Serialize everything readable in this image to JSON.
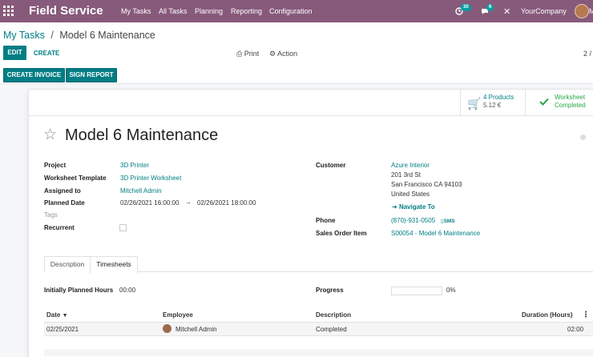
{
  "navbar": {
    "app_name": "Field Service",
    "menu": [
      "My Tasks",
      "All Tasks",
      "Planning",
      "Reporting",
      "Configuration"
    ],
    "activity_count": "30",
    "message_count": "6",
    "company": "YourCompany",
    "user_initial": "M"
  },
  "breadcrumb": {
    "parent": "My Tasks",
    "separator": "/",
    "current": "Model 6 Maintenance"
  },
  "buttons": {
    "edit": "EDIT",
    "create": "CREATE",
    "print": "Print",
    "action": "Action",
    "pager": "2 /",
    "create_invoice": "CREATE INVOICE",
    "sign_report": "SIGN REPORT"
  },
  "smart_buttons": {
    "products_count": "4 Products",
    "products_amount": "5.12 €",
    "worksheet_line1": "Worksheet",
    "worksheet_line2": "Completed"
  },
  "record": {
    "title": "Model 6 Maintenance",
    "left_fields": {
      "project_label": "Project",
      "project": "3D Printer",
      "worksheet_label": "Worksheet Template",
      "worksheet": "3D Printer Worksheet",
      "assigned_label": "Assigned to",
      "assigned": "Mitchell Admin",
      "planned_label": "Planned Date",
      "planned_start": "02/26/2021 16:00:00",
      "planned_arrow": "→",
      "planned_end": "02/26/2021 18:00:00",
      "tags_label": "Tags",
      "recurrent_label": "Recurrent"
    },
    "right_fields": {
      "customer_label": "Customer",
      "customer": "Azure Interior",
      "address1": "201 3rd St",
      "address2": "San Francisco CA 94103",
      "address3": "United States",
      "navigate": "Navigate To",
      "phone_label": "Phone",
      "phone": "(870)-931-0505",
      "sms": "SMS",
      "so_label": "Sales Order Item",
      "so": "S00054 - Model 6 Maintenance"
    }
  },
  "tabs": {
    "description": "Description",
    "timesheets": "Timesheets"
  },
  "timesheet": {
    "planned_label": "Initially Planned Hours",
    "planned_value": "00:00",
    "progress_label": "Progress",
    "progress_text": "0%",
    "progress_value": 0,
    "columns": {
      "date": "Date",
      "employee": "Employee",
      "description": "Description",
      "duration": "Duration (Hours)"
    },
    "rows": [
      {
        "date": "02/25/2021",
        "employee": "Mitchell Admin",
        "description": "Completed",
        "duration": "02:00"
      }
    ]
  },
  "colors": {
    "brand": "#875a7b",
    "primary": "#017e84",
    "success": "#28a745"
  }
}
